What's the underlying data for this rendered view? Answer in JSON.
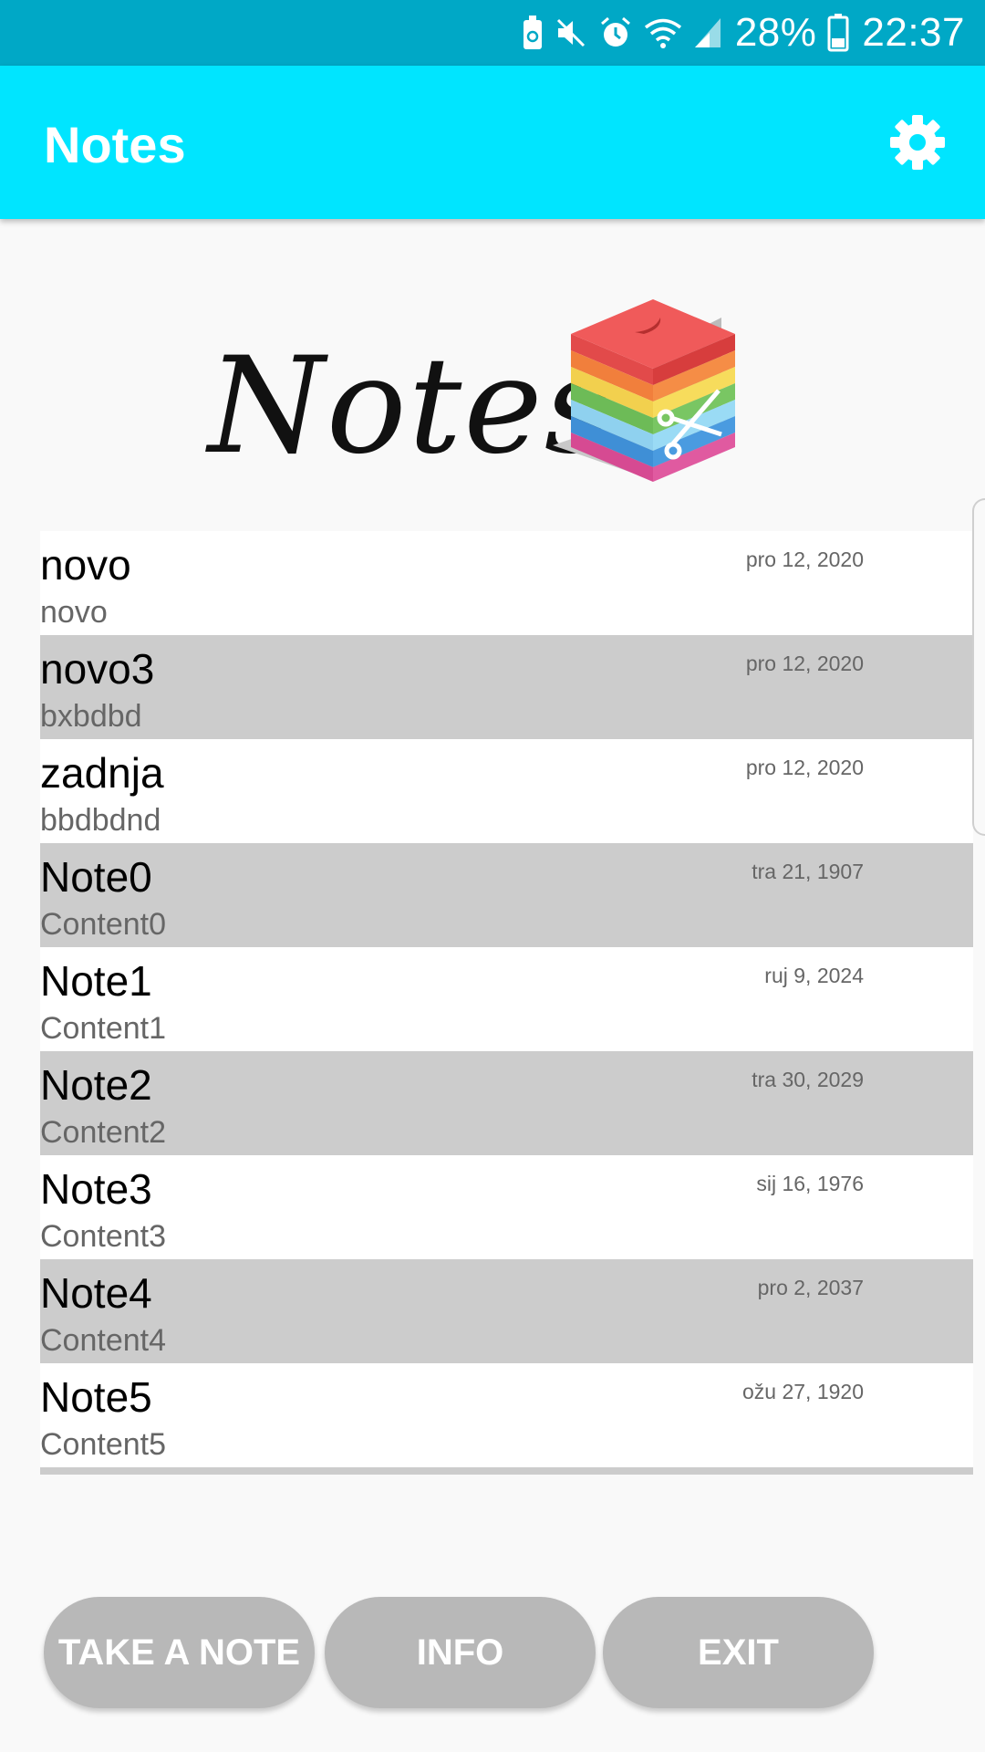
{
  "status_bar": {
    "battery_percent": "28%",
    "time": "22:37",
    "icons": [
      "battery-saver-icon",
      "mute-icon",
      "alarm-icon",
      "wifi-icon",
      "cell-signal-icon",
      "battery-icon"
    ]
  },
  "app_bar": {
    "title": "Notes",
    "settings_icon": "gear-icon"
  },
  "logo": {
    "text": "Notes",
    "icon": "sticky-notes-cube-icon"
  },
  "notes": [
    {
      "title": "novo",
      "content": "novo",
      "date": "pro 12, 2020"
    },
    {
      "title": "novo3",
      "content": "bxbdbd",
      "date": "pro 12, 2020"
    },
    {
      "title": "zadnja",
      "content": "bbdbdnd",
      "date": "pro 12, 2020"
    },
    {
      "title": "Note0",
      "content": "Content0",
      "date": "tra 21, 1907"
    },
    {
      "title": "Note1",
      "content": "Content1",
      "date": "ruj 9, 2024"
    },
    {
      "title": "Note2",
      "content": "Content2",
      "date": "tra 30, 2029"
    },
    {
      "title": "Note3",
      "content": "Content3",
      "date": "sij 16, 1976"
    },
    {
      "title": "Note4",
      "content": "Content4",
      "date": "pro 2, 2037"
    },
    {
      "title": "Note5",
      "content": "Content5",
      "date": "ožu 27, 1920"
    }
  ],
  "buttons": {
    "take_note": "TAKE A NOTE",
    "info": "INFO",
    "exit": "EXIT"
  },
  "colors": {
    "status_bar": "#00a8c6",
    "app_bar": "#00e5ff",
    "row_alt": "#cccccc",
    "button": "#b8b8b8"
  }
}
